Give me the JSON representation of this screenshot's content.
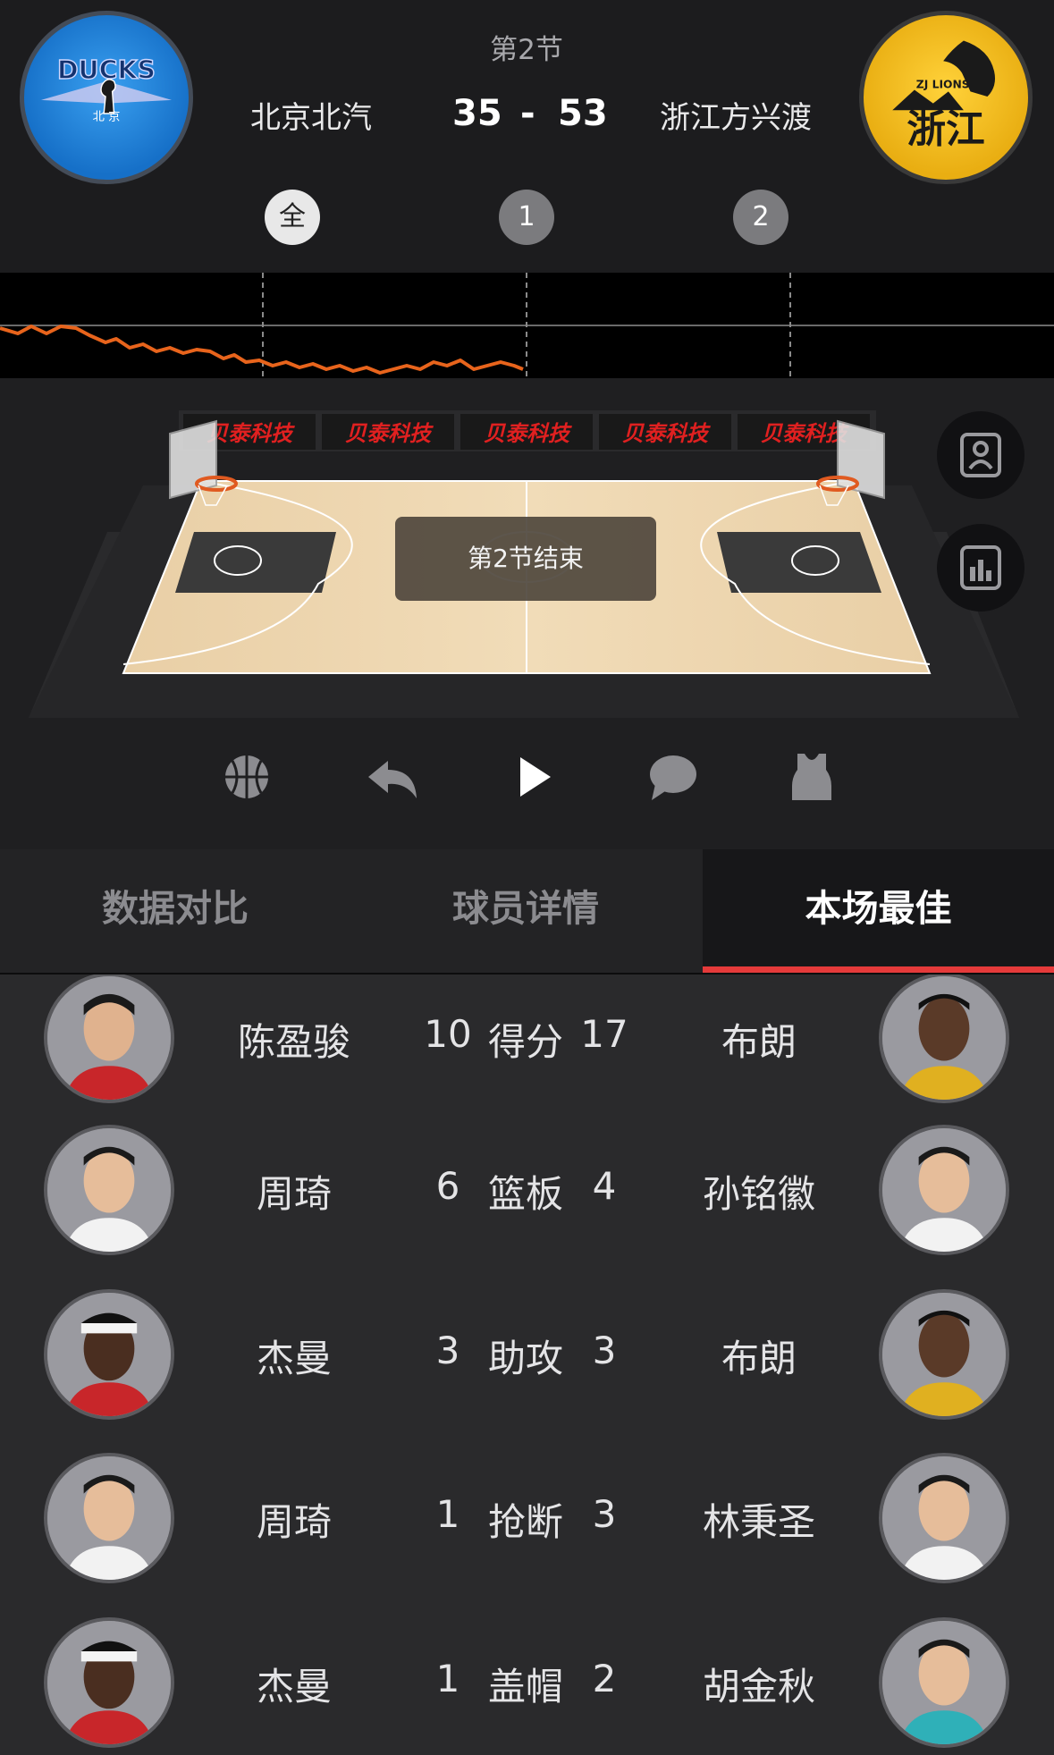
{
  "header": {
    "period_title": "第2节",
    "home_team": {
      "name": "北京北汽",
      "score": "35",
      "logo_text": "DUCKS",
      "logo_subtext": "北 京"
    },
    "away_team": {
      "name": "浙江方兴渡",
      "score": "53",
      "logo_text": "浙江",
      "logo_subtext": "ZJ LIONS"
    },
    "score_separator": "-",
    "quarter_buttons": [
      "全",
      "1",
      "2"
    ]
  },
  "court": {
    "sponsor_banners": [
      "贝泰科技",
      "贝泰科技",
      "贝泰科技",
      "贝泰科技",
      "贝泰科技"
    ],
    "status_text": "第2节结束"
  },
  "side_buttons": [
    "profile-icon",
    "stats-icon"
  ],
  "controls": [
    "basketball-icon",
    "replay-icon",
    "play-icon",
    "comment-icon",
    "jersey-icon"
  ],
  "tabs": [
    "数据对比",
    "球员详情",
    "本场最佳"
  ],
  "active_tab": "本场最佳",
  "best_players": [
    {
      "left_name": "陈盈骏",
      "left_value": "10",
      "stat": "得分",
      "right_value": "17",
      "right_name": "布朗"
    },
    {
      "left_name": "周琦",
      "left_value": "6",
      "stat": "篮板",
      "right_value": "4",
      "right_name": "孙铭徽"
    },
    {
      "left_name": "杰曼",
      "left_value": "3",
      "stat": "助攻",
      "right_value": "3",
      "right_name": "布朗"
    },
    {
      "left_name": "周琦",
      "left_value": "1",
      "stat": "抢断",
      "right_value": "3",
      "right_name": "林秉圣"
    },
    {
      "left_name": "杰曼",
      "left_value": "1",
      "stat": "盖帽",
      "right_value": "2",
      "right_name": "胡金秋"
    }
  ],
  "colors": {
    "accent_red": "#e53a3a",
    "trend_line": "#e8641c",
    "home_logo": "#1670c8",
    "away_logo": "#e9ae12"
  }
}
